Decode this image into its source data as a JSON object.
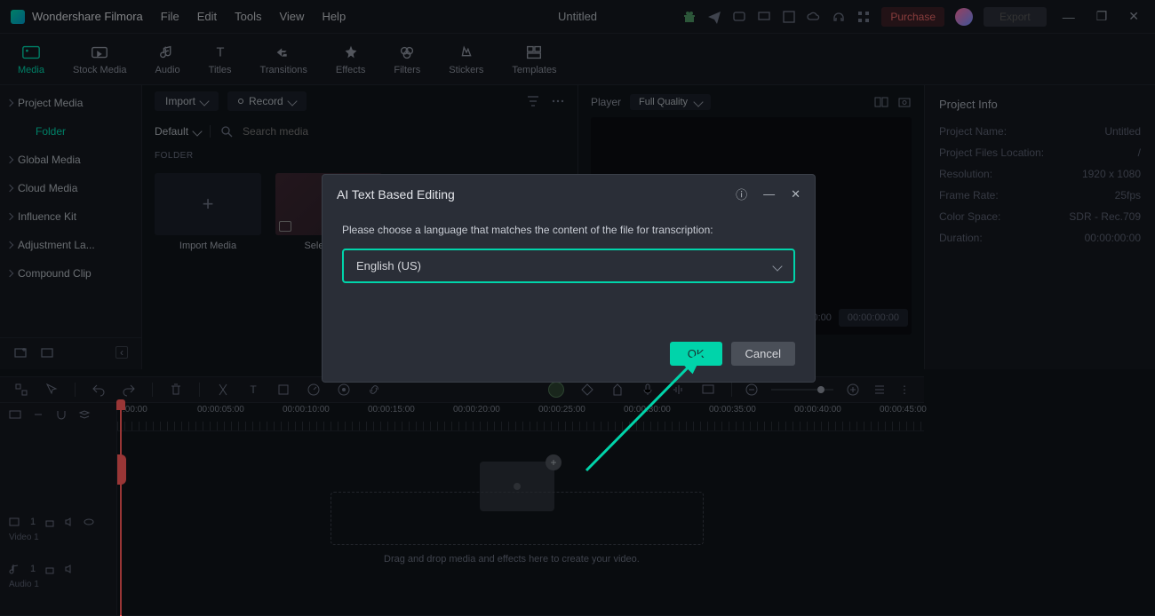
{
  "app": {
    "name": "Wondershare Filmora",
    "title": "Untitled"
  },
  "menu": [
    "File",
    "Edit",
    "Tools",
    "View",
    "Help"
  ],
  "titlebar": {
    "purchase": "Purchase",
    "export": "Export"
  },
  "toolbar": [
    "Media",
    "Stock Media",
    "Audio",
    "Titles",
    "Transitions",
    "Effects",
    "Filters",
    "Stickers",
    "Templates"
  ],
  "sidebar": {
    "items": [
      "Project Media",
      "Folder",
      "Global Media",
      "Cloud Media",
      "Influence Kit",
      "Adjustment La...",
      "Compound Clip"
    ]
  },
  "media_panel": {
    "import": "Import",
    "record": "Record",
    "default": "Default",
    "search_ph": "Search media",
    "section": "FOLDER",
    "tiles": {
      "import_media": "Import Media",
      "clip1": "Selena G..."
    }
  },
  "preview": {
    "tab": "Player",
    "quality": "Full Quality"
  },
  "project_info": {
    "title": "Project Info",
    "rows": {
      "name_l": "Project Name:",
      "name_v": "Untitled",
      "loc_l": "Project Files Location:",
      "loc_v": "/",
      "res_l": "Resolution:",
      "res_v": "1920 x 1080",
      "fps_l": "Frame Rate:",
      "fps_v": "25fps",
      "cs_l": "Color Space:",
      "cs_v": "SDR - Rec.709",
      "dur_l": "Duration:",
      "dur_v": "00:00:00:00"
    }
  },
  "time": {
    "a": "00:00:00:00",
    "b": "00:00:00:00"
  },
  "ruler": [
    ":00:00",
    "00:00:05:00",
    "00:00:10:00",
    "00:00:15:00",
    "00:00:20:00",
    "00:00:25:00",
    "00:00:30:00",
    "00:00:35:00",
    "00:00:40:00",
    "00:00:45:00"
  ],
  "tracks": {
    "video": "Video 1",
    "audio": "Audio 1"
  },
  "timeline": {
    "hint": "Drag and drop media and effects here to create your video."
  },
  "modal": {
    "title": "AI Text Based Editing",
    "msg": "Please choose a language that matches the content of the file for transcription:",
    "lang": "English (US)",
    "ok": "OK",
    "cancel": "Cancel"
  }
}
